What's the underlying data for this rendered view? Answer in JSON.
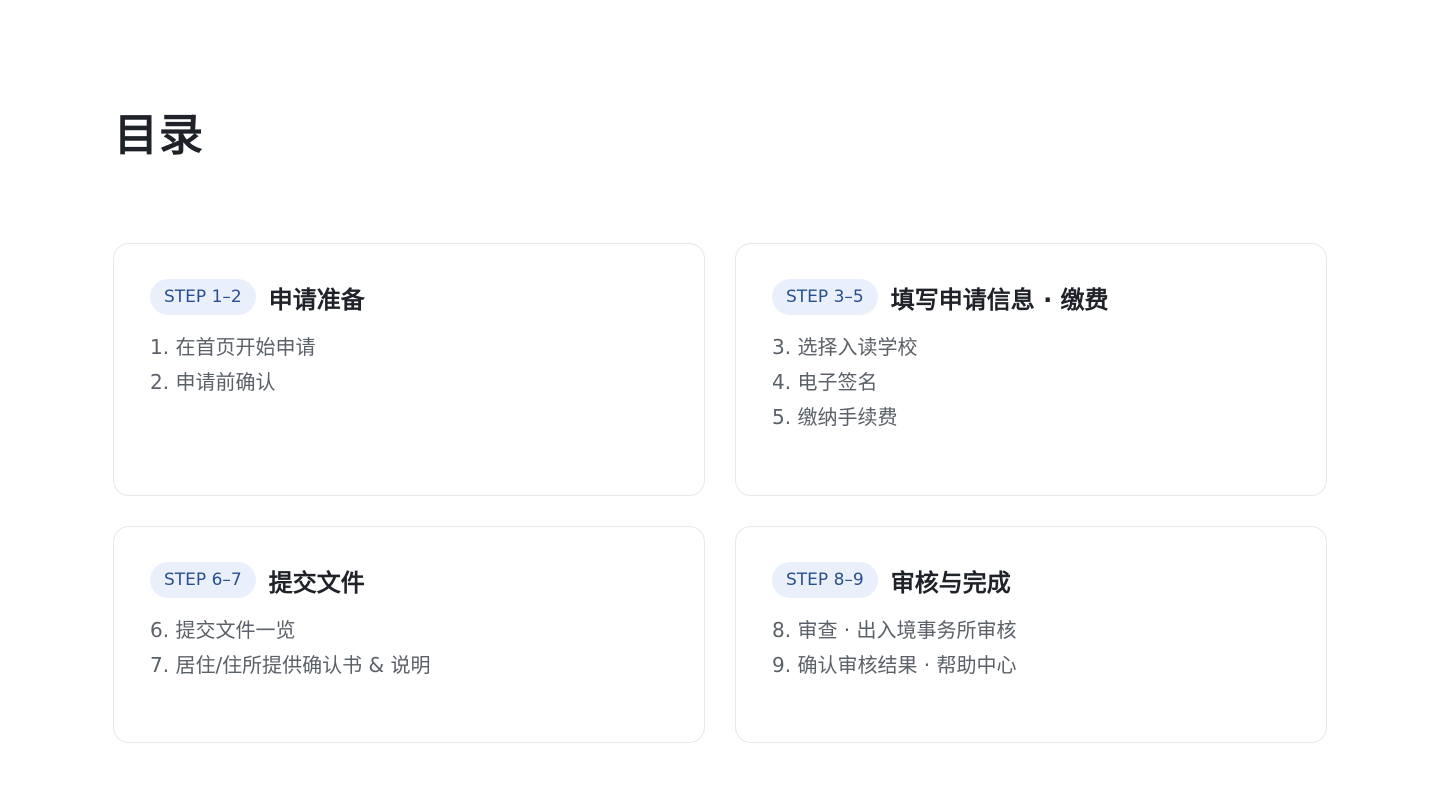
{
  "page": {
    "title": "目录"
  },
  "sections": [
    {
      "step": "STEP 1–2",
      "title": "申请准备",
      "items": [
        "1. 在首页开始申请",
        "2. 申请前确认"
      ]
    },
    {
      "step": "STEP 3–5",
      "title": "填写申请信息 · 缴费",
      "items": [
        "3. 选择入读学校",
        "4. 电子签名",
        "5. 缴纳手续费"
      ]
    },
    {
      "step": "STEP 6–7",
      "title": "提交文件",
      "items": [
        "6. 提交文件一览",
        "7. 居住/住所提供确认书 & 说明"
      ]
    },
    {
      "step": "STEP 8–9",
      "title": "审核与完成",
      "items": [
        "8. 审查 · 出入境事务所审核",
        "9. 确认审核结果 · 帮助中心"
      ]
    }
  ],
  "colors": {
    "badge_background": "#eaf0fb",
    "badge_text": "#2a4f8f",
    "title_text": "#1f2329",
    "item_text": "#5b6168",
    "card_border": "#e6e8ec"
  }
}
